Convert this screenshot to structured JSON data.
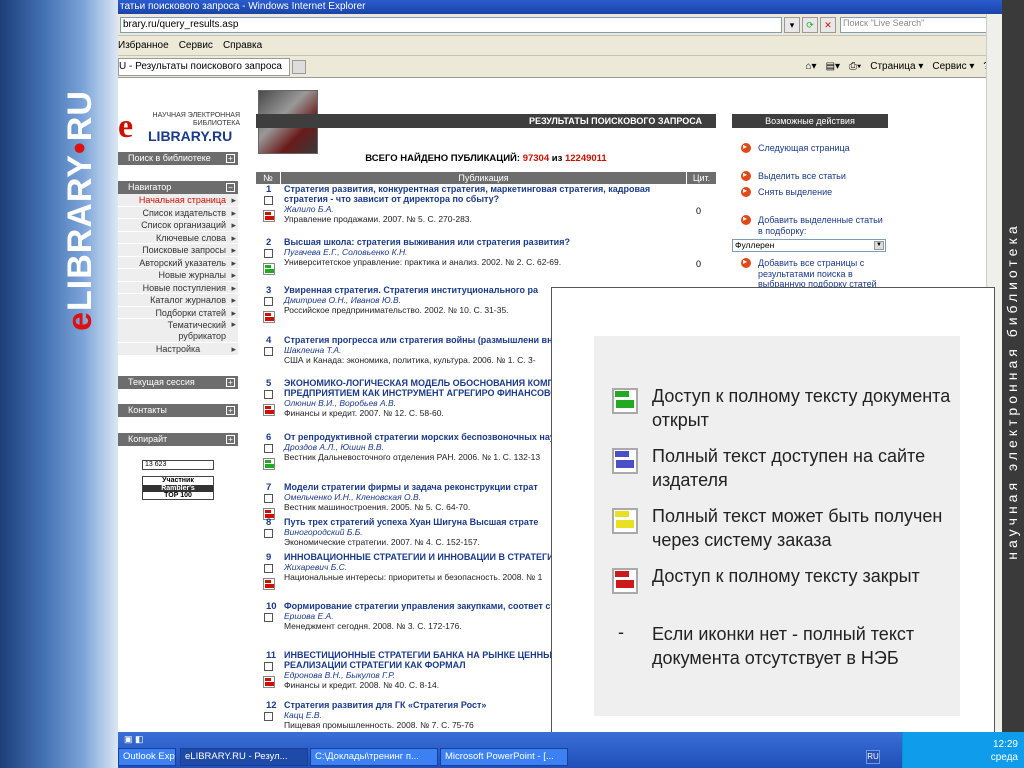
{
  "slide": {
    "left_logo": {
      "prefix": "e",
      "text": "LIBRARY",
      "dot": "•",
      "suffix": "RU"
    },
    "right_vertical_text": "научная электронная библиотека"
  },
  "window": {
    "title": "татьи поискового запроса - Windows Internet Explorer"
  },
  "address": {
    "url": "brary.ru/query_results.asp",
    "search_placeholder": "Поиск \"Live Search\""
  },
  "menu": [
    "Избранное",
    "Сервис",
    "Справка"
  ],
  "tab": {
    "label": "U - Результаты поискового запроса"
  },
  "commands": [
    "Страница ▾",
    "Сервис ▾"
  ],
  "logo": {
    "letter": "e",
    "line1": "НАУЧНАЯ ЭЛЕКТРОННАЯ БИБЛИОТЕКА",
    "line2": "LIBRARY.RU"
  },
  "sidebar": {
    "search_header": "Поиск в библиотеке",
    "navigator_header": "Навигатор",
    "nav_items": [
      "Начальная страница",
      "Список издательств",
      "Список организаций",
      "Ключевые слова",
      "Поисковые запросы",
      "Авторский указатель",
      "Новые журналы",
      "Новые поступления",
      "Каталог журналов",
      "Подборки статей",
      "Тематический рубрикатор"
    ],
    "settings": "Настройка",
    "session_header": "Текущая сессия",
    "contacts_header": "Контакты",
    "copyright_header": "Копирайт",
    "counter": "13 623",
    "rambler": [
      "Участник",
      "Rambler's",
      "TOP 100"
    ]
  },
  "results": {
    "title": "РЕЗУЛЬТАТЫ ПОИСКОВОГО ЗАПРОСА",
    "count_label": "ВСЕГО НАЙДЕНО ПУБЛИКАЦИЙ:",
    "found": "97304",
    "of": "из",
    "total": "12249011",
    "columns": [
      "№",
      "Публикация",
      "Цит."
    ],
    "rows": [
      {
        "num": "1",
        "title": "Стратегия развития, конкурентная стратегия, маркетинговая стратегия, кадровая стратегия - что зависит от директора по сбыту?",
        "authors": "Жалило Б.А.",
        "source": "Управление продажами. 2007. № 5. С. 270-283.",
        "cit": "0",
        "pdf": "red"
      },
      {
        "num": "2",
        "title": "Высшая школа: стратегия выживания или стратегия развития?",
        "authors": "Пугачева Е.Г., Соловьенко К.Н.",
        "source": "Университетское управление: практика и анализ. 2002. № 2. С. 62-69.",
        "cit": "0",
        "pdf": "green"
      },
      {
        "num": "3",
        "title": "Увиренная стратегия. Стратегия институционального ра",
        "authors": "Дмитриев О.Н., Иванов Ю.В.",
        "source": "Российское предпринимательство. 2002. № 10. С. 31-35.",
        "cit": "",
        "pdf": "red"
      },
      {
        "num": "4",
        "title": "Стратегия прогресса или стратегия войны (размышлени внешнеполитической мысли)",
        "authors": "Шаклеина Т.А.",
        "source": "США и Канада: экономика, политика, культура. 2006. № 1. С. 3-",
        "cit": "",
        "pdf": "none"
      },
      {
        "num": "5",
        "title": "ЭКОНОМИКО-ЛОГИЧЕСКАЯ МОДЕЛЬ ОБОСНОВАНИЯ КОМПЛ УПРАВЛЕНИЯ ПРЕДПРИЯТИЕМ КАК ИНСТРУМЕНТ АГРЕГИРО ФИНАНСОВОЙ СТРАТЕГИИ",
        "authors": "Олюнин В.И., Воробьев А.В.",
        "source": "Финансы и кредит. 2007. № 12. С. 58-60.",
        "cit": "",
        "pdf": "red"
      },
      {
        "num": "6",
        "title": "От репродуктивной стратегии морских беспозвоночных науки",
        "authors": "Дроздов А.Л., Юшин В.В.",
        "source": "Вестник Дальневосточного отделения РАН. 2006. № 1. С. 132-13",
        "cit": "",
        "pdf": "green"
      },
      {
        "num": "7",
        "title": "Модели стратегии фирмы и задача реконструкции страт",
        "authors": "Омельченко И.Н., Кленовская О.В.",
        "source": "Вестник машиностроения. 2005. № 5. С. 64-70.",
        "cit": "",
        "pdf": "red"
      },
      {
        "num": "8",
        "title": "Путь трех стратегий успеха Хуан Шигуна Высшая страте",
        "authors": "Виногородский Б.Б.",
        "source": "Экономические стратегии. 2007. № 4. С. 152-157.",
        "cit": "",
        "pdf": "none"
      },
      {
        "num": "9",
        "title": "ИННОВАЦИОННЫЕ СТРАТЕГИИ И ИННОВАЦИИ В СТРАТЕГИЯ",
        "authors": "Жихаревич Б.С.",
        "source": "Национальные интересы: приоритеты и безопасность. 2008. № 1",
        "cit": "",
        "pdf": "red"
      },
      {
        "num": "10",
        "title": "Формирование стратегии управления закупками, соответ стратегии компании",
        "authors": "Ершова Е.А.",
        "source": "Менеджмент сегодня. 2008. № 3. С. 172-176.",
        "cit": "",
        "pdf": "none"
      },
      {
        "num": "11",
        "title": "ИНВЕСТИЦИОННЫЕ СТРАТЕГИИ БАНКА НА РЫНКЕ ЦЕННЫХ Б ФОРМИРОВАНИЯ И РЕАЛИЗАЦИИ СТРАТЕГИИ КАК ФОРМАЛ",
        "authors": "Едронова В.Н., Быкулов Г.Р.",
        "source": "Финансы и кредит. 2008. № 40. С. 8-14.",
        "cit": "",
        "pdf": "red"
      },
      {
        "num": "12",
        "title": "Стратегия развития для ГК «Стратегия Рост»",
        "authors": "Кацц Е.В.",
        "source": "Пищевая промышленность. 2008. № 7. С. 75-76",
        "cit": "",
        "pdf": "none"
      }
    ]
  },
  "actions": {
    "header": "Возможные действия",
    "items": [
      "Следующая страница",
      "Выделить все статьи",
      "Снять выделение",
      "Добавить выделенные статьи в подборку:",
      "Добавить все страницы с результатами поиска в выбранную подборку статей"
    ],
    "select_value": "Фуллерен"
  },
  "legend": {
    "items": [
      {
        "text": "Доступ к полному тексту документа открыт",
        "color": "#22aa22"
      },
      {
        "text": "Полный текст доступен на сайте издателя",
        "color": "#4a50c8"
      },
      {
        "text": "Полный текст может быть получен через систему заказа",
        "color": "#e8e020"
      },
      {
        "text": "Доступ к полному тексту закрыт",
        "color": "#cc1a1a"
      }
    ],
    "dash": "-",
    "no_icon": "Если иконки нет - полный текст документа отсутствует в НЭБ"
  },
  "taskbar": {
    "items": [
      "Outlook Exp...",
      "eLIBRARY.RU - Резул...",
      "C:\\Доклады\\тренинг п...",
      "Microsoft PowerPoint - [..."
    ],
    "lang": "RU",
    "time": "12:29",
    "day": "среда"
  }
}
